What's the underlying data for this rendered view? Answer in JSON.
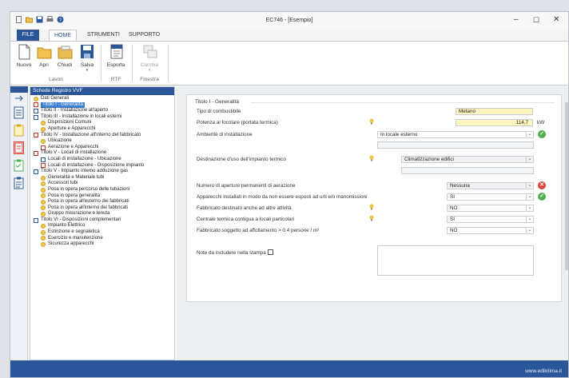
{
  "window": {
    "title": "EC746 - [Esempio]"
  },
  "ribbon_tabs": {
    "file": "FILE",
    "home": "HOME",
    "strumenti": "STRUMENTI",
    "supporto": "SUPPORTO"
  },
  "ribbon": {
    "nuovo": "Nuovo",
    "apri": "Apri",
    "chiudi": "Chiudi",
    "salva": "Salva",
    "salva_arrow": "▾",
    "esporta": "Esporta",
    "cambia": "Cambia",
    "cambia_arrow": "▾",
    "group_lavori": "Lavori",
    "group_rtf": "RTF",
    "group_finestra": "Finestra"
  },
  "tree": {
    "header": "Schede Registro VVF",
    "nodes": [
      {
        "label": "Dati Generali",
        "icon": "leaf",
        "level": 0
      },
      {
        "label": "Titolo I - Generalità",
        "icon": "docr",
        "level": 0,
        "selected": true
      },
      {
        "label": "Titolo II - Installazione all'aperto",
        "icon": "doc",
        "level": 0
      },
      {
        "label": "Titolo III - Installazione in locali esterni",
        "icon": "doc",
        "level": 0
      },
      {
        "label": "Disposizioni Comuni",
        "icon": "leaf",
        "level": 1
      },
      {
        "label": "Aperture e Apparecchi",
        "icon": "leaf",
        "level": 1
      },
      {
        "label": "Titolo IV - Installazione all'interno del fabbricato",
        "icon": "docr",
        "level": 0
      },
      {
        "label": "Ubicazione",
        "icon": "leaf",
        "level": 1
      },
      {
        "label": "Aerazione e Apparecchi",
        "icon": "docr",
        "level": 1
      },
      {
        "label": "Titolo V - Locali di installazione",
        "icon": "docr",
        "level": 0
      },
      {
        "label": "Locali di installazione - Ubicazione",
        "icon": "doc",
        "level": 1
      },
      {
        "label": "Locali di installazione - Disposizione impianto",
        "icon": "docr",
        "level": 1
      },
      {
        "label": "Titolo V - Impianto interno adduzione gas",
        "icon": "doc",
        "level": 0
      },
      {
        "label": "Generalità e Materiale tubi",
        "icon": "leaf",
        "level": 1
      },
      {
        "label": "Accessori tubi",
        "icon": "leaf",
        "level": 1
      },
      {
        "label": "Posa in opera percorso delle tubazioni",
        "icon": "leaf",
        "level": 1
      },
      {
        "label": "Posa in opera generalità",
        "icon": "leaf",
        "level": 1
      },
      {
        "label": "Posa in opera all'esterno dei fabbricati",
        "icon": "leaf",
        "level": 1
      },
      {
        "label": "Posa in opera all'interno dei fabbricati",
        "icon": "leaf",
        "level": 1
      },
      {
        "label": "Gruppo misurazione e tenuta",
        "icon": "leaf",
        "level": 1
      },
      {
        "label": "Titolo VI - Disposizioni complementari",
        "icon": "doc",
        "level": 0
      },
      {
        "label": "Impianto Elettrico",
        "icon": "leaf",
        "level": 1
      },
      {
        "label": "Estinzione e segnaletica",
        "icon": "leaf",
        "level": 1
      },
      {
        "label": "Esercizio e manutenzione",
        "icon": "leaf",
        "level": 1
      },
      {
        "label": "Sicurezza apparecchi",
        "icon": "leaf",
        "level": 1
      }
    ]
  },
  "form": {
    "section_title": "Titolo I - Generalità",
    "tipo_combustibile_label": "Tipo di combustibile",
    "tipo_combustibile_value": "Metano",
    "potenza_label": "Potenza al focolare (portata termica)",
    "potenza_value": "114,7",
    "potenza_unit": "kW",
    "ambiente_label": "Ambiente di installazione",
    "ambiente_value": "In locale esterno",
    "destinazione_label": "Destinazione d'uso dell'impianto termico",
    "destinazione_value": "Climatizzazione edifici",
    "aperture_label": "Numero di aperture permanenti di aerazione",
    "aperture_value": "Nessuna",
    "apparecchi_label": "Apparecchi installati in modo da non essere esposti ad urti e/o manomissioni",
    "apparecchi_value": "SI",
    "fabbricato_label": "Fabbricato destinato anche ad altre attività",
    "fabbricato_value": "NO",
    "centrale_label": "Centrale termica contigua a locali particolari",
    "centrale_value": "SI",
    "affollamento_label": "Fabbricato soggetto ad affollamento > 0.4 persone / m²",
    "affollamento_value": "NO",
    "note_label": "Note da includere nella stampa"
  },
  "status": {
    "website": "www.edilclima.it"
  }
}
